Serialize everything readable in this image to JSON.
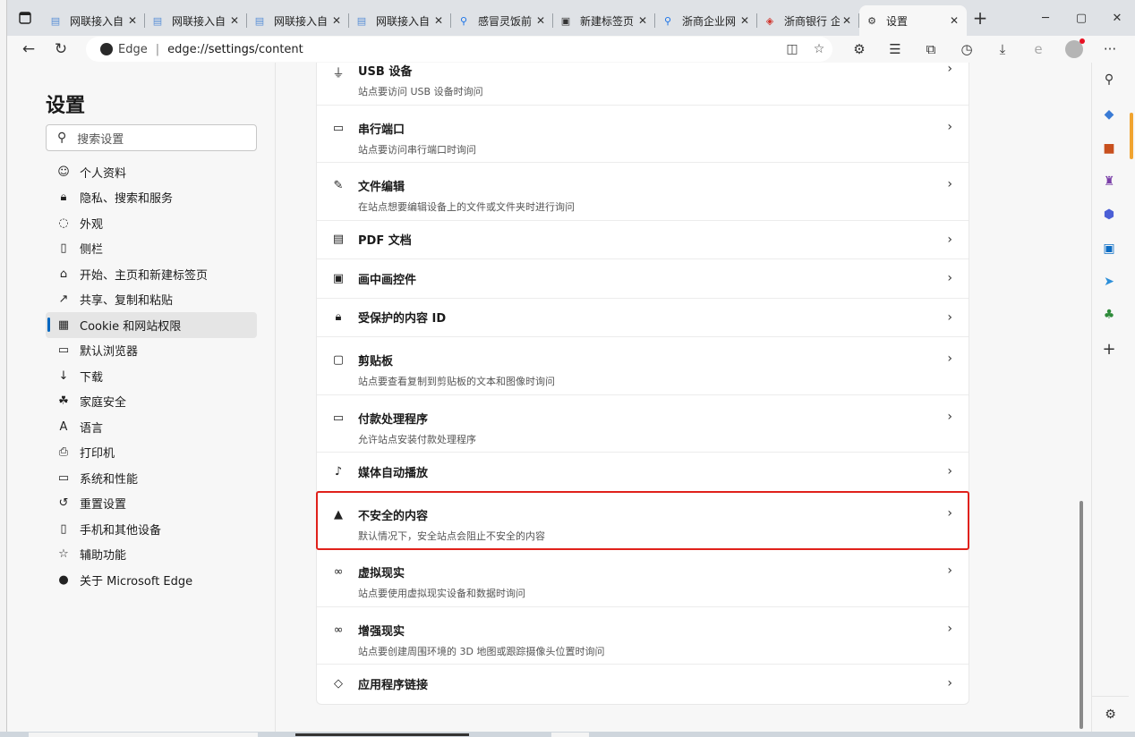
{
  "tabs": [
    {
      "title": "网联接入自",
      "icon": "page-icon",
      "active": false
    },
    {
      "title": "网联接入自",
      "icon": "page-icon",
      "active": false
    },
    {
      "title": "网联接入自",
      "icon": "page-icon",
      "active": false
    },
    {
      "title": "网联接入自",
      "icon": "page-icon",
      "active": false
    },
    {
      "title": "感冒灵饭前",
      "icon": "search-icon",
      "active": false
    },
    {
      "title": "新建标签页",
      "icon": "newtab-icon",
      "active": false
    },
    {
      "title": "浙商企业网",
      "icon": "search-icon",
      "active": false
    },
    {
      "title": "浙商银行 企",
      "icon": "bank-icon",
      "active": false
    },
    {
      "title": "设置",
      "icon": "gear-icon",
      "active": true
    }
  ],
  "address": {
    "site": "Edge",
    "url_prefix": "edge://",
    "url_bold": "settings",
    "url_suffix": "/content"
  },
  "sidebar": {
    "title": "设置",
    "search_placeholder": "搜索设置",
    "items": [
      {
        "label": "个人资料",
        "icon": "profile-icon"
      },
      {
        "label": "隐私、搜索和服务",
        "icon": "lock-icon"
      },
      {
        "label": "外观",
        "icon": "palette-icon"
      },
      {
        "label": "侧栏",
        "icon": "sidebar-icon"
      },
      {
        "label": "开始、主页和新建标签页",
        "icon": "home-icon"
      },
      {
        "label": "共享、复制和粘贴",
        "icon": "share-icon"
      },
      {
        "label": "Cookie 和网站权限",
        "icon": "cookie-icon",
        "active": true
      },
      {
        "label": "默认浏览器",
        "icon": "browser-icon"
      },
      {
        "label": "下载",
        "icon": "download-icon"
      },
      {
        "label": "家庭安全",
        "icon": "family-icon"
      },
      {
        "label": "语言",
        "icon": "language-icon"
      },
      {
        "label": "打印机",
        "icon": "printer-icon"
      },
      {
        "label": "系统和性能",
        "icon": "laptop-icon"
      },
      {
        "label": "重置设置",
        "icon": "reset-icon"
      },
      {
        "label": "手机和其他设备",
        "icon": "phone-icon"
      },
      {
        "label": "辅助功能",
        "icon": "accessibility-icon"
      },
      {
        "label": "关于 Microsoft Edge",
        "icon": "edge-logo-icon"
      }
    ]
  },
  "content": {
    "rows": [
      {
        "title": "USB 设备",
        "desc": "站点要访问 USB 设备时询问",
        "icon": "usb-icon"
      },
      {
        "title": "串行端口",
        "desc": "站点要访问串行端口时询问",
        "icon": "serial-port-icon"
      },
      {
        "title": "文件编辑",
        "desc": "在站点想要编辑设备上的文件或文件夹时进行询问",
        "icon": "file-edit-icon"
      },
      {
        "title": "PDF 文档",
        "desc": "",
        "icon": "pdf-icon"
      },
      {
        "title": "画中画控件",
        "desc": "",
        "icon": "pip-icon"
      },
      {
        "title": "受保护的内容 ID",
        "desc": "",
        "icon": "lock-icon"
      },
      {
        "title": "剪贴板",
        "desc": "站点要查看复制到剪贴板的文本和图像时询问",
        "icon": "clipboard-icon"
      },
      {
        "title": "付款处理程序",
        "desc": "允许站点安装付款处理程序",
        "icon": "card-icon"
      },
      {
        "title": "媒体自动播放",
        "desc": "",
        "icon": "music-icon"
      },
      {
        "title": "不安全的内容",
        "desc": "默认情况下，安全站点会阻止不安全的内容",
        "icon": "warning-icon",
        "highlight": true
      },
      {
        "title": "虚拟现实",
        "desc": "站点要使用虚拟现实设备和数据时询问",
        "icon": "vr-icon"
      },
      {
        "title": "增强现实",
        "desc": "站点要创建周围环境的 3D 地图或跟踪摄像头位置时询问",
        "icon": "ar-icon"
      },
      {
        "title": "应用程序链接",
        "desc": "",
        "icon": "link-icon"
      }
    ]
  },
  "colors": {
    "accent": "#0067c0",
    "highlight": "#e0211b"
  }
}
